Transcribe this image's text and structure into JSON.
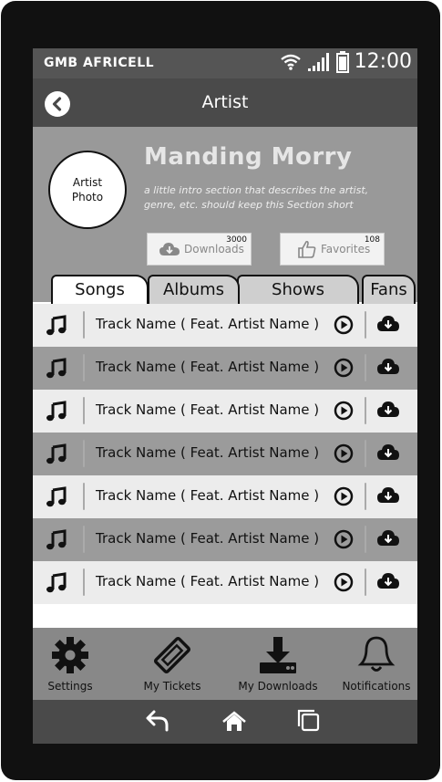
{
  "status": {
    "carrier": "GMB AFRICELL",
    "time": "12:00"
  },
  "header": {
    "title": "Artist"
  },
  "artist": {
    "photo_line1": "Artist",
    "photo_line2": "Photo",
    "name": "Manding Morry",
    "intro": "a little intro section that describes the artist, genre, etc.  should keep this Section short",
    "downloads": {
      "label": "Downloads",
      "count": "3000"
    },
    "favorites": {
      "label": "Favorites",
      "count": "108"
    }
  },
  "tabs": [
    {
      "label": "Songs"
    },
    {
      "label": "Albums"
    },
    {
      "label": "Shows"
    },
    {
      "label": "Fans"
    }
  ],
  "songs": [
    {
      "title": "Track Name ( Feat. Artist Name )"
    },
    {
      "title": "Track Name ( Feat. Artist Name )"
    },
    {
      "title": "Track Name ( Feat. Artist Name )"
    },
    {
      "title": "Track Name ( Feat. Artist Name )"
    },
    {
      "title": "Track Name ( Feat. Artist Name )"
    },
    {
      "title": "Track Name ( Feat. Artist Name )"
    },
    {
      "title": "Track Name ( Feat. Artist Name )"
    }
  ],
  "nav": {
    "settings": "Settings",
    "tickets": "My Tickets",
    "downloads": "My Downloads",
    "notifications": "Notifications"
  },
  "colors": {
    "row_light": "#ececec",
    "row_dark": "#9b9b9b",
    "appbar": "#4a4a4a",
    "profile_bg": "#999999"
  }
}
